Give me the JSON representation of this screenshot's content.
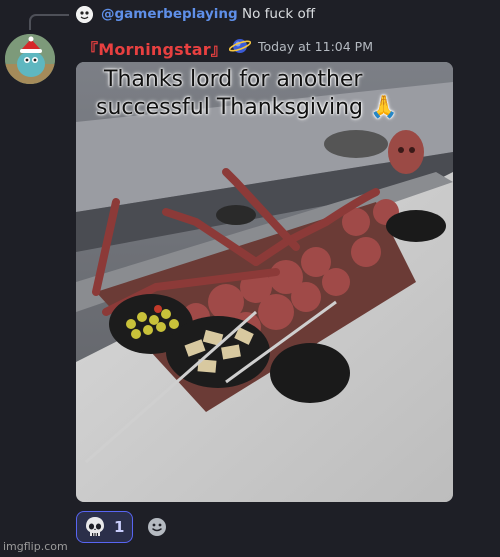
{
  "reply": {
    "username": "@gamerbeplaying",
    "text": "No fuck off"
  },
  "message": {
    "username": "『Morningstar』",
    "timestamp": "Today at 11:04 PM",
    "username_color": "#e84040",
    "attachment": {
      "caption_line1": "Thanks lord for another",
      "caption_line2": "successful Thanksgiving 🙏"
    }
  },
  "reactions": [
    {
      "emoji": "skull-icon",
      "count": "1"
    }
  ],
  "watermark": "imgflip.com",
  "colors": {
    "background": "#1e1f26",
    "mention": "#5f8fe8",
    "reaction_border": "#5865f2"
  }
}
